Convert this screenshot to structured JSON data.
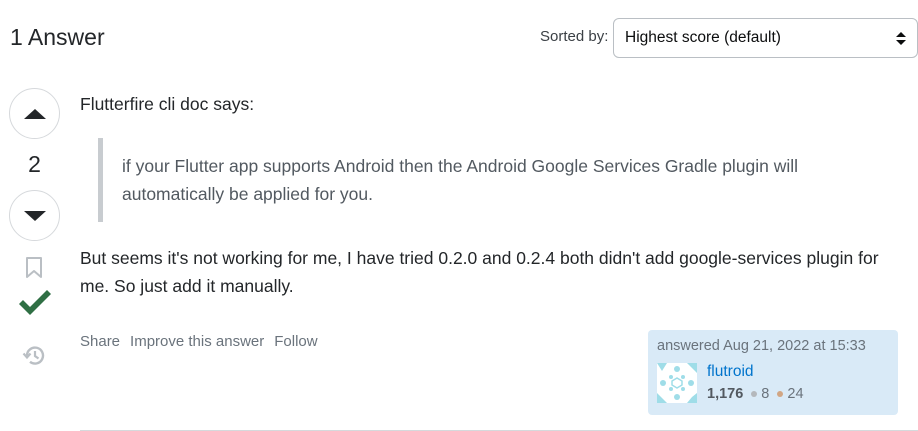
{
  "header": {
    "answer_count_label": "1 Answer",
    "sort_label": "Sorted by:",
    "sort_selected": "Highest score (default)"
  },
  "voting": {
    "score": "2",
    "accepted": true
  },
  "answer": {
    "intro": "Flutterfire cli doc says:",
    "quote": "if your Flutter app supports Android then the Android Google Services Gradle plugin will automatically be applied for you.",
    "outro": "But seems it's not working for me, I have tried 0.2.0 and 0.2.4 both didn't add google-services plugin for me. So just add it manually."
  },
  "menu": {
    "share": "Share",
    "improve": "Improve this answer",
    "follow": "Follow"
  },
  "user_card": {
    "action_time": "answered Aug 21, 2022 at 15:33",
    "user_name": "flutroid",
    "reputation": "1,176",
    "silver_badges": "8",
    "bronze_badges": "24"
  },
  "colors": {
    "accepted_green": "#2f6f44",
    "link_blue": "#0074cc",
    "card_bg": "#d9eaf7"
  }
}
